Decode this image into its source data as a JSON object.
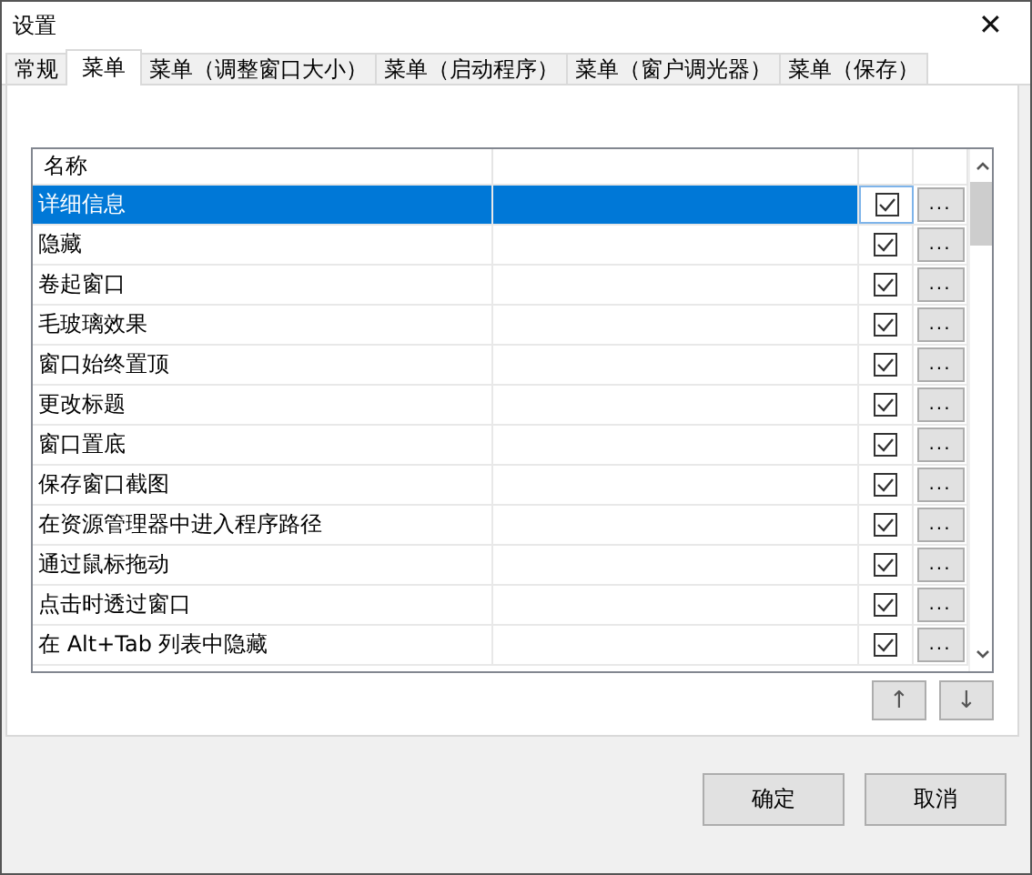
{
  "window": {
    "title": "设置",
    "close": "✕"
  },
  "tabs": [
    {
      "label": "常规",
      "selected": false
    },
    {
      "label": "菜单",
      "selected": true
    },
    {
      "label": "菜单（调整窗口大小）",
      "selected": false
    },
    {
      "label": "菜单（启动程序）",
      "selected": false
    },
    {
      "label": "菜单（窗户调光器）",
      "selected": false
    },
    {
      "label": "菜单（保存）",
      "selected": false
    }
  ],
  "table": {
    "columns": [
      "名称"
    ],
    "rows": [
      {
        "name": "详细信息",
        "checked": true,
        "selected": true,
        "button": "..."
      },
      {
        "name": "隐藏",
        "checked": true,
        "selected": false,
        "button": "..."
      },
      {
        "name": "卷起窗口",
        "checked": true,
        "selected": false,
        "button": "..."
      },
      {
        "name": "毛玻璃效果",
        "checked": true,
        "selected": false,
        "button": "..."
      },
      {
        "name": "窗口始终置顶",
        "checked": true,
        "selected": false,
        "button": "..."
      },
      {
        "name": "更改标题",
        "checked": true,
        "selected": false,
        "button": "..."
      },
      {
        "name": "窗口置底",
        "checked": true,
        "selected": false,
        "button": "..."
      },
      {
        "name": "保存窗口截图",
        "checked": true,
        "selected": false,
        "button": "..."
      },
      {
        "name": "在资源管理器中进入程序路径",
        "checked": true,
        "selected": false,
        "button": "..."
      },
      {
        "name": "通过鼠标拖动",
        "checked": true,
        "selected": false,
        "button": "..."
      },
      {
        "name": "点击时透过窗口",
        "checked": true,
        "selected": false,
        "button": "..."
      },
      {
        "name": "在 Alt+Tab 列表中隐藏",
        "checked": true,
        "selected": false,
        "button": "..."
      }
    ]
  },
  "move_buttons": [
    "↑",
    "↓"
  ],
  "buttons": [
    "确定",
    "取消"
  ]
}
